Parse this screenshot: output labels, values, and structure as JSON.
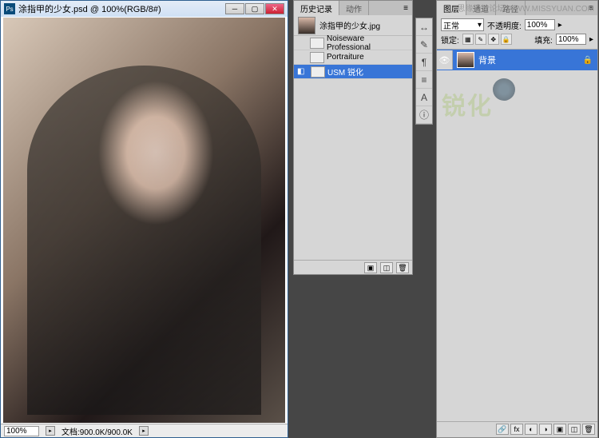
{
  "doc": {
    "title": "涂指甲的少女.psd @ 100%(RGB/8#)",
    "zoom": "100%",
    "status": "文档:900.0K/900.0K"
  },
  "history": {
    "tab_history": "历史记录",
    "tab_actions": "动作",
    "doc_name": "涂指甲的少女.jpg",
    "items": [
      {
        "label": "Noiseware Professional"
      },
      {
        "label": "Portraiture"
      },
      {
        "label": "USM 锐化"
      }
    ]
  },
  "layers": {
    "tab_layers": "图层",
    "tab_channels": "通道",
    "tab_paths": "路径",
    "blend_mode": "正常",
    "opacity_label": "不透明度:",
    "opacity_value": "100%",
    "lock_label": "锁定:",
    "fill_label": "填充:",
    "fill_value": "100%",
    "layer_name": "背景"
  },
  "watermark": {
    "text": "锐化",
    "site": "思缘设计论坛   WWW.MISSYUAN.COM"
  }
}
